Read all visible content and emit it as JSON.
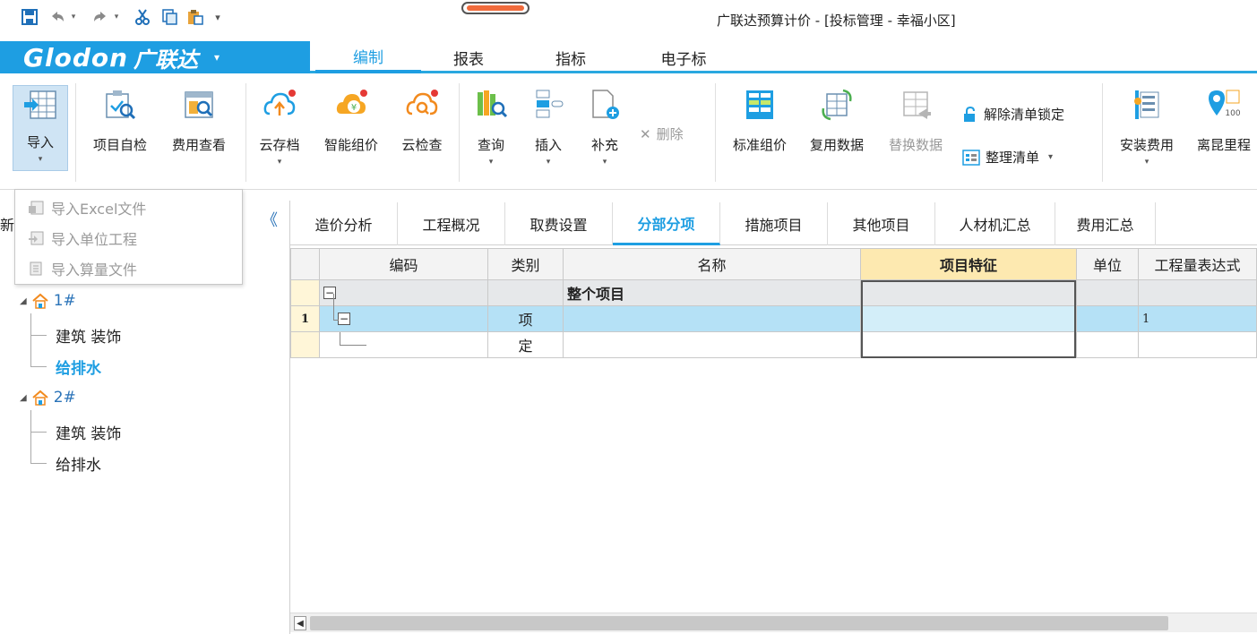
{
  "window": {
    "title": "广联达预算计价 - [投标管理 - 幸福小区]"
  },
  "quick_access": {
    "icons": [
      "save-icon",
      "undo-icon",
      "redo-icon",
      "cut-icon",
      "copy-icon",
      "paste-icon",
      "customize-icon"
    ]
  },
  "brand": {
    "logo": "Glodon",
    "name": "广联达",
    "caret": "▾"
  },
  "menu": {
    "tabs": [
      "编制",
      "报表",
      "指标",
      "电子标"
    ],
    "active": "编制"
  },
  "ribbon": {
    "import": "导入",
    "self_check": "项目自检",
    "fee_view": "费用查看",
    "cloud_save": "云存档",
    "smart_price": "智能组价",
    "cloud_check": "云检查",
    "query": "查询",
    "insert": "插入",
    "supplement": "补充",
    "delete": "删除",
    "standard_price": "标准组价",
    "reuse_data": "复用数据",
    "replace_data": "替换数据",
    "unlock_list": "解除清单锁定",
    "organize_list": "整理清单",
    "install_fee": "安装费用",
    "distance": "离昆里程"
  },
  "import_menu": {
    "items": [
      "导入Excel文件",
      "导入单位工程",
      "导入算量文件"
    ]
  },
  "tree": {
    "partial_label": "新",
    "collapse": "《",
    "nodes": [
      {
        "label": "1#",
        "children": [
          "建筑 装饰",
          "给排水"
        ]
      },
      {
        "label": "2#",
        "children": [
          "建筑 装饰",
          "给排水"
        ]
      }
    ],
    "selected": "给排水"
  },
  "content_tabs": {
    "items": [
      "造价分析",
      "工程概况",
      "取费设置",
      "分部分项",
      "措施项目",
      "其他项目",
      "人材机汇总",
      "费用汇总"
    ],
    "active": "分部分项"
  },
  "grid": {
    "headers": [
      "编码",
      "类别",
      "名称",
      "项目特征",
      "单位",
      "工程量表达式"
    ],
    "rows": [
      {
        "num": "",
        "code": "",
        "type": "",
        "name": "整个项目",
        "feature": "",
        "unit": "",
        "qty": ""
      },
      {
        "num": "1",
        "code": "",
        "type": "项",
        "name": "",
        "feature": "",
        "unit": "",
        "qty": "1"
      },
      {
        "num": "",
        "code": "",
        "type": "定",
        "name": "",
        "feature": "",
        "unit": "",
        "qty": ""
      }
    ],
    "expander_symbol": "−"
  },
  "colors": {
    "accent": "#1e9ee2",
    "selected_row": "#b5e1f6",
    "feature_header": "#fde9b0"
  }
}
